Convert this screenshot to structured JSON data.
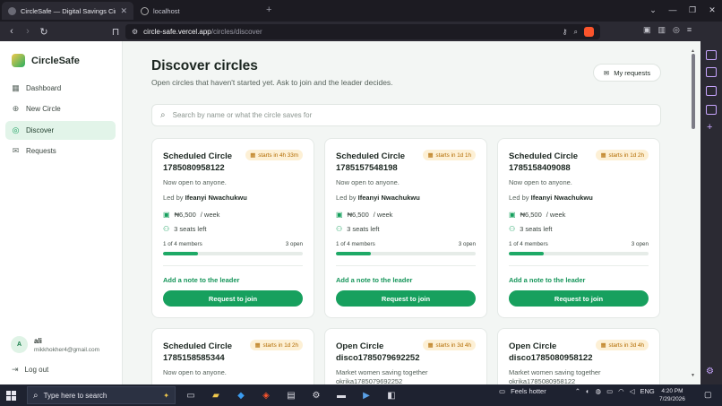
{
  "browser": {
    "tabs": [
      {
        "title": "CircleSafe — Digital Savings Circ",
        "active": true
      },
      {
        "title": "localhost",
        "active": false
      }
    ],
    "url_host": "circle-safe.vercel.app",
    "url_path": "/circles/discover"
  },
  "sidebar": {
    "brand": "CircleSafe",
    "items": [
      {
        "label": "Dashboard",
        "icon": "grid-icon",
        "active": false
      },
      {
        "label": "New Circle",
        "icon": "plus-circle-icon",
        "active": false
      },
      {
        "label": "Discover",
        "icon": "compass-icon",
        "active": true
      },
      {
        "label": "Requests",
        "icon": "inbox-icon",
        "active": false
      }
    ],
    "user": {
      "initial": "A",
      "name": "ali",
      "email": "mikkhokher4@gmail.com"
    },
    "logout_label": "Log out"
  },
  "main": {
    "title": "Discover circles",
    "subtitle": "Open circles that haven't started yet. Ask to join and the leader decides.",
    "my_requests_label": "My requests",
    "search_placeholder": "Search by name or what the circle saves for"
  },
  "cards": [
    {
      "title": "Scheduled Circle 1785080958122",
      "badge": "starts in 4h 33m",
      "desc": "Now open to anyone.",
      "led_prefix": "Led by",
      "leader": "Ifeanyi Nwachukwu",
      "amount": "₦6,500",
      "period": "/ week",
      "seats": "3 seats left",
      "members": "1 of 4 members",
      "open": "3 open",
      "progress": 0.25,
      "note_label": "Add a note to the leader",
      "join_label": "Request to join"
    },
    {
      "title": "Scheduled Circle 1785157548198",
      "badge": "starts in 1d 1h",
      "desc": "Now open to anyone.",
      "led_prefix": "Led by",
      "leader": "Ifeanyi Nwachukwu",
      "amount": "₦6,500",
      "period": "/ week",
      "seats": "3 seats left",
      "members": "1 of 4 members",
      "open": "3 open",
      "progress": 0.25,
      "note_label": "Add a note to the leader",
      "join_label": "Request to join"
    },
    {
      "title": "Scheduled Circle 1785158409088",
      "badge": "starts in 1d 2h",
      "desc": "Now open to anyone.",
      "led_prefix": "Led by",
      "leader": "Ifeanyi Nwachukwu",
      "amount": "₦6,500",
      "period": "/ week",
      "seats": "3 seats left",
      "members": "1 of 4 members",
      "open": "3 open",
      "progress": 0.25,
      "note_label": "Add a note to the leader",
      "join_label": "Request to join"
    },
    {
      "title": "Scheduled Circle 1785158585344",
      "badge": "starts in 1d 2h",
      "desc": "Now open to anyone."
    },
    {
      "title": "Open Circle disco1785079692252",
      "badge": "starts in 3d 4h",
      "desc": "Market women saving together okrika1785079692252"
    },
    {
      "title": "Open Circle disco1785080958122",
      "badge": "starts in 3d 4h",
      "desc": "Market women saving together okrika1785080958122"
    }
  ],
  "taskbar": {
    "search_placeholder": "Type here to search",
    "weather": "Feels hotter",
    "lang": "ENG",
    "time": "4:20 PM",
    "date": "7/29/2026"
  },
  "colors": {
    "accent": "#17a05e",
    "badge_bg": "#fdf0d5",
    "badge_text": "#b26b00",
    "active_nav": "#e2f4e9"
  }
}
